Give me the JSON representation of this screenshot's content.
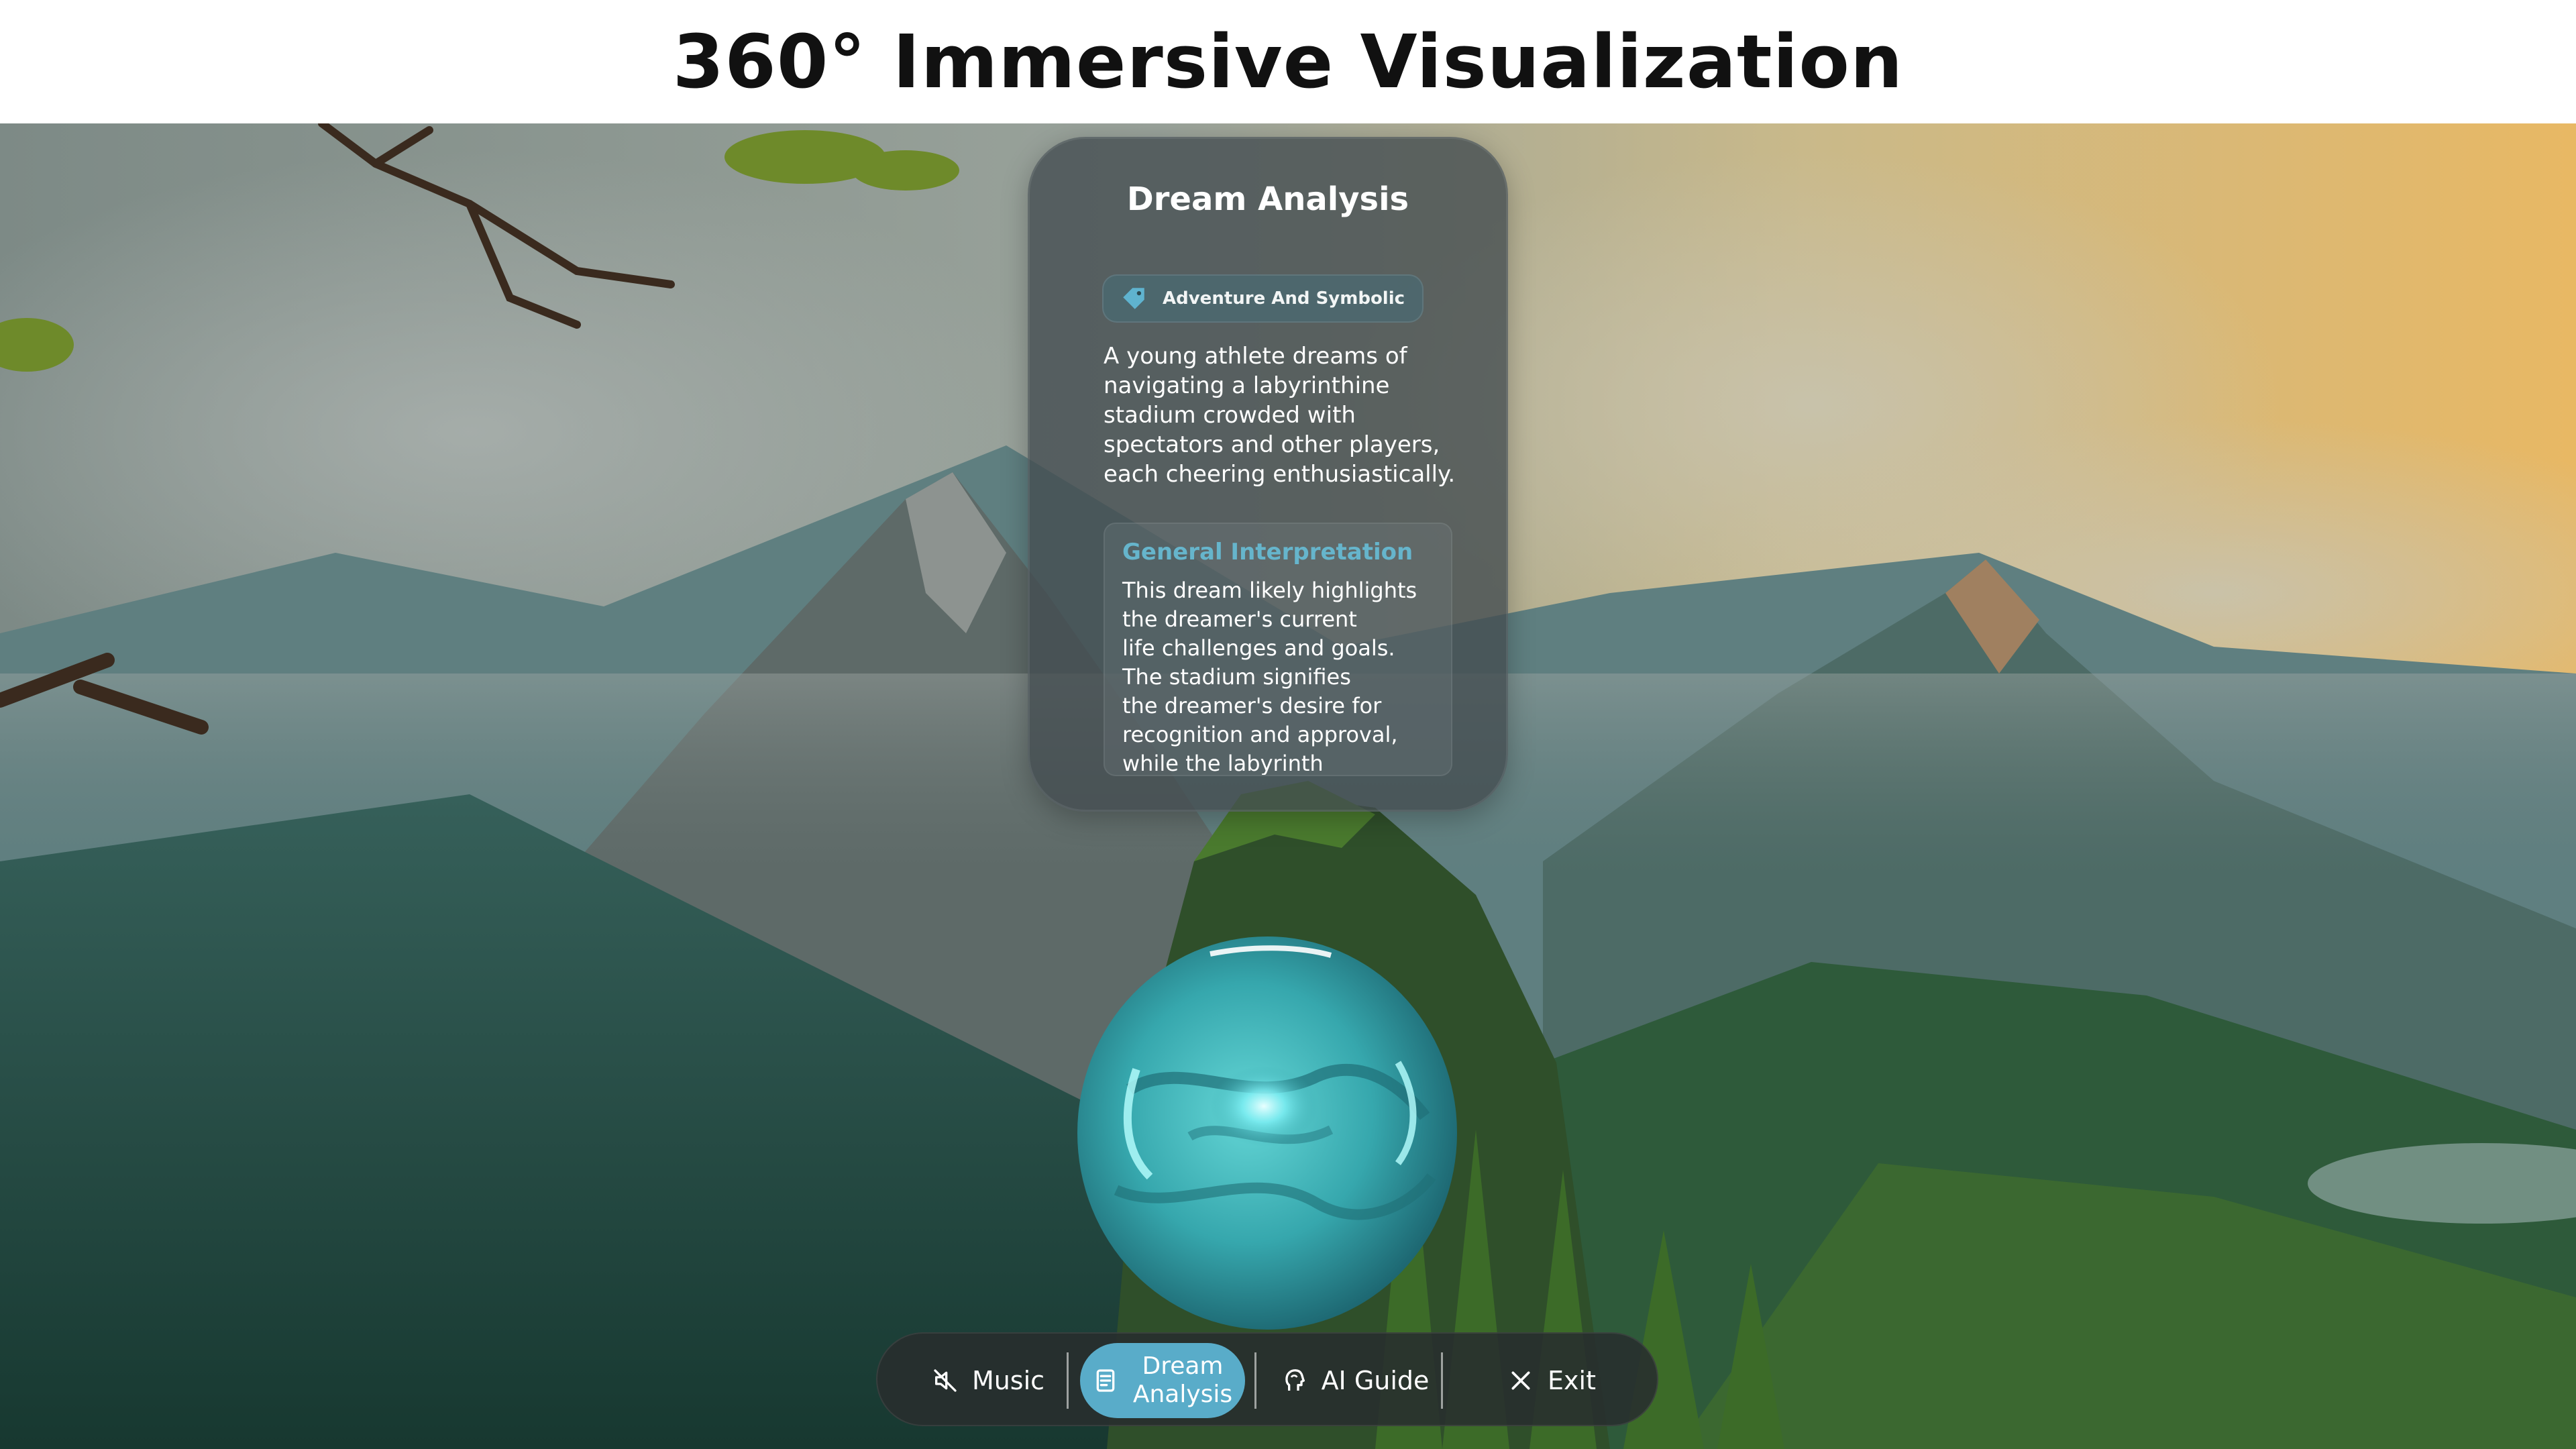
{
  "page": {
    "title": "360° Immersive Visualization"
  },
  "card": {
    "title": "Dream Analysis",
    "tag": {
      "label": "Adventure And Symbolic",
      "icon": "tag-icon"
    },
    "summary": "A young athlete dreams of navigating a labyrinthine stadium crowded with spectators and other players, each cheering enthusiastically.",
    "interpretation": {
      "title": "General Interpretation",
      "lines": [
        "This dream likely highlights",
        "the dreamer's current",
        "life challenges and goals.",
        "The stadium signifies",
        "the dreamer's desire for",
        "recognition and approval,",
        "while the labyrinth represents"
      ]
    }
  },
  "toolbar": {
    "music": {
      "label": "Music",
      "icon": "speaker-muted-icon"
    },
    "dream_analysis": {
      "label_line1": "Dream",
      "label_line2": "Analysis",
      "icon": "book-icon",
      "active": true
    },
    "ai_guide": {
      "label": "AI Guide",
      "icon": "head-icon"
    },
    "exit": {
      "label": "Exit",
      "icon": "close-icon"
    }
  },
  "colors": {
    "accent": "#59acc9",
    "card_bg": "#424c50",
    "interpretation_title": "#66b5cc",
    "orb": "#3fb3b8"
  }
}
